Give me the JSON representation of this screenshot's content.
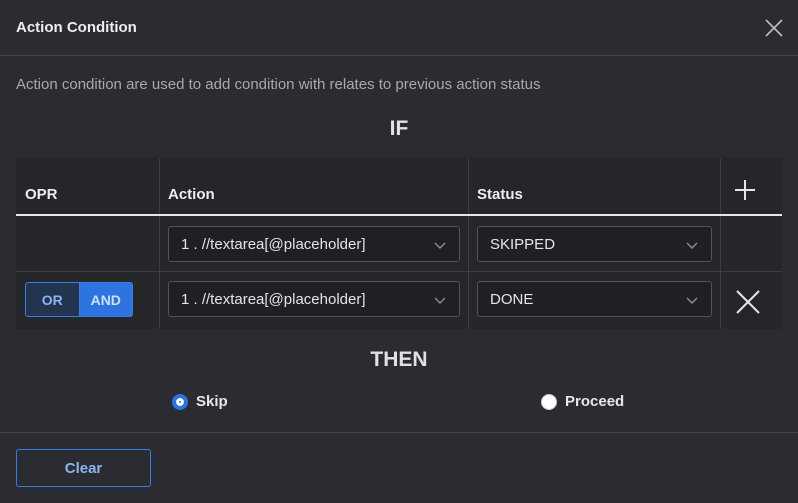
{
  "dialog": {
    "title": "Action Condition",
    "description": "Action condition are used to add condition with relates to previous action status",
    "if_title": "IF",
    "then_title": "THEN"
  },
  "table": {
    "headers": {
      "opr": "OPR",
      "action": "Action",
      "status": "Status"
    },
    "rows": [
      {
        "action": "1 . //textarea[@placeholder]",
        "status": "SKIPPED"
      },
      {
        "opr": {
          "or": "OR",
          "and": "AND",
          "selected": "AND"
        },
        "action": "1 . //textarea[@placeholder]",
        "status": "DONE"
      }
    ]
  },
  "then": {
    "options": [
      {
        "label": "Skip",
        "selected": true
      },
      {
        "label": "Proceed",
        "selected": false
      }
    ]
  },
  "footer": {
    "clear_label": "Clear"
  },
  "icons": {
    "close": "close-icon",
    "add": "plus-icon",
    "delete": "x-icon",
    "dropdown": "chevron-down-icon"
  },
  "colors": {
    "accent": "#2d74e0",
    "background": "#2b2c31",
    "table_bg": "#25262a"
  }
}
